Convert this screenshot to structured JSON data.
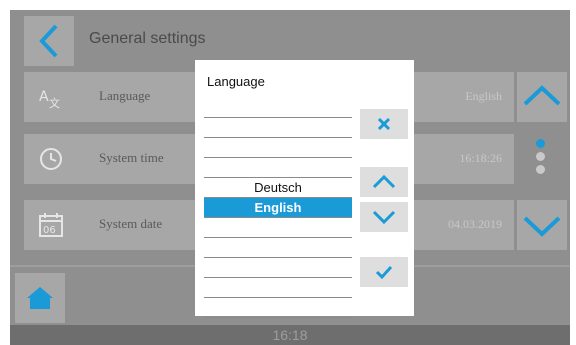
{
  "header": {
    "title": "General settings"
  },
  "rows": [
    {
      "label": "Language",
      "value": "English",
      "icon": "language-icon"
    },
    {
      "label": "System time",
      "value": "16:18:26",
      "icon": "clock-icon"
    },
    {
      "label": "System date",
      "value": "04.03.2019",
      "icon": "calendar-icon"
    }
  ],
  "status": {
    "clock": "16:18"
  },
  "dialog": {
    "title": "Language",
    "items": [
      "",
      "",
      "",
      "",
      "Deutsch",
      "English",
      "",
      "",
      "",
      "",
      ""
    ],
    "selected_index": 5
  },
  "colors": {
    "accent": "#1b9ad8",
    "panel": "#a7a7a7",
    "background": "#8f8f8f"
  },
  "icons": {
    "back": "chevron-left-icon",
    "scroll_up": "chevron-up-icon",
    "scroll_down": "chevron-down-icon",
    "home": "home-icon",
    "close": "close-icon",
    "confirm": "checkmark-icon"
  }
}
